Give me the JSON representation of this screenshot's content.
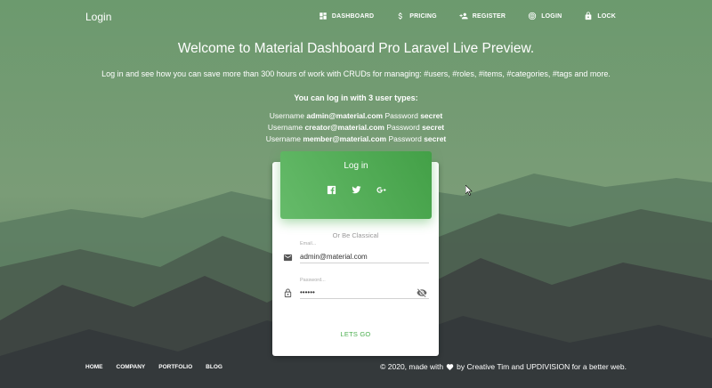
{
  "navbar": {
    "brand": "Login",
    "items": [
      {
        "label": "DASHBOARD",
        "icon": "dashboard-icon"
      },
      {
        "label": "PRICING",
        "icon": "dollar-icon"
      },
      {
        "label": "REGISTER",
        "icon": "person-add-icon"
      },
      {
        "label": "LOGIN",
        "icon": "fingerprint-icon"
      },
      {
        "label": "LOCK",
        "icon": "lock-icon"
      }
    ]
  },
  "hero": {
    "title": "Welcome to Material Dashboard Pro Laravel Live Preview.",
    "description": "Log in and see how you can save more than 300 hours of work with CRUDs for managing: #users, #roles, #items, #categories, #tags and more.",
    "subtitle": "You can log in with 3 user types:",
    "credentials": [
      {
        "user_label": "Username",
        "username": "admin@material.com",
        "pass_label": "Password",
        "password": "secret"
      },
      {
        "user_label": "Username",
        "username": "creator@material.com",
        "pass_label": "Password",
        "password": "secret"
      },
      {
        "user_label": "Username",
        "username": "member@material.com",
        "pass_label": "Password",
        "password": "secret"
      }
    ]
  },
  "login_card": {
    "title": "Log in",
    "socials": [
      "facebook-icon",
      "twitter-icon",
      "google-plus-icon"
    ],
    "or_text": "Or Be Classical",
    "email": {
      "label": "Email...",
      "value": "admin@material.com"
    },
    "password": {
      "label": "Password...",
      "value": "••••••"
    },
    "submit_label": "LETS GO"
  },
  "footer": {
    "links": [
      "HOME",
      "COMPANY",
      "PORTFOLIO",
      "BLOG"
    ],
    "copyright_prefix": "© 2020, made with",
    "copyright_suffix": "by Creative Tim and UPDIVISION for a better web."
  },
  "colors": {
    "accent": "#4caf50",
    "accent_dark": "#43a047"
  }
}
